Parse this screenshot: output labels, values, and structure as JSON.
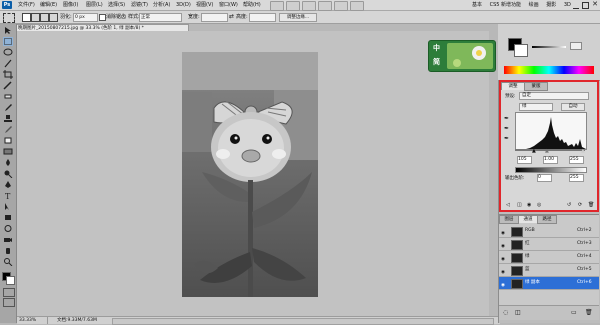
{
  "app": {
    "logo": "Ps",
    "menus": [
      "文件(F)",
      "编辑(E)",
      "图像(I)",
      "图层(L)",
      "选择(S)",
      "滤镜(T)",
      "分析(A)",
      "3D(D)",
      "视图(V)",
      "窗口(W)",
      "帮助(H)"
    ],
    "workspace_buttons": [
      "基本",
      "CS5 新增功能",
      "绘画",
      "摄影",
      "3D"
    ]
  },
  "options": {
    "feather_label": "羽化:",
    "feather_value": "0 px",
    "antialias_label": "消除锯齿",
    "style_label": "样式:",
    "style_value": "正常",
    "width_label": "宽度:",
    "height_label": "高度:",
    "refine_edge": "调整边缘..."
  },
  "document": {
    "tab_title": "晚期图片_20150807215.jpg @ 33.3% (色阶 1, 绿 副本/8) *"
  },
  "status": {
    "zoom": "33.33%",
    "doc_info": "文档:9.33M/7.63M"
  },
  "ime": {
    "mode_top": "中",
    "mode_bottom": "简"
  },
  "adjustments": {
    "tabs": [
      "调整",
      "蒙版"
    ],
    "preset_label": "预设:",
    "preset_value": "自定",
    "channel_value": "绿",
    "auto_button": "自动",
    "input_black": "105",
    "input_gamma": "1.00",
    "input_white": "255",
    "output_label": "输出色阶:",
    "output_black": "0",
    "output_white": "255"
  },
  "layers": {
    "tabs": [
      "图层",
      "通道",
      "路径"
    ],
    "rows": [
      {
        "name": "RGB",
        "shortcut": "Ctrl+2",
        "selected": false
      },
      {
        "name": "红",
        "shortcut": "Ctrl+3",
        "selected": false
      },
      {
        "name": "绿",
        "shortcut": "Ctrl+4",
        "selected": false
      },
      {
        "name": "蓝",
        "shortcut": "Ctrl+5",
        "selected": false
      },
      {
        "name": "绿 副本",
        "shortcut": "Ctrl+6",
        "selected": true
      }
    ]
  },
  "colors": {
    "highlight": "#e0262b",
    "selection": "#2d6fd6",
    "ps_blue": "#0b5ea8"
  }
}
